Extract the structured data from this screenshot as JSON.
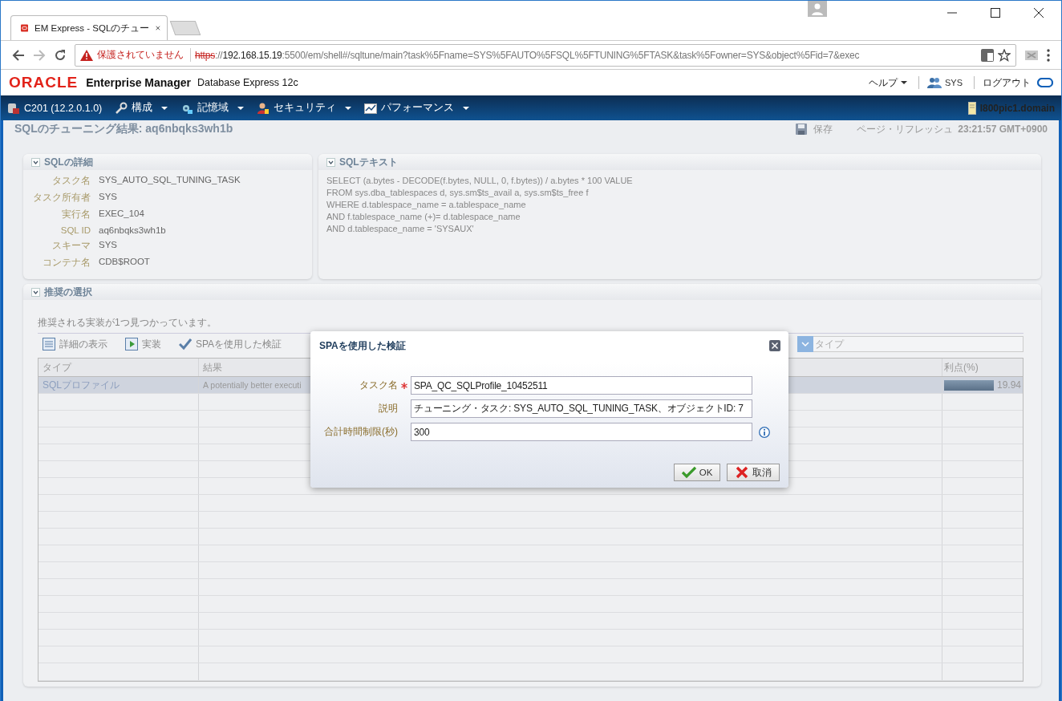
{
  "browser": {
    "tab_title": "EM Express - SQLのチュー",
    "url": {
      "warning": "保護されていません",
      "scheme": "https",
      "separator": "://",
      "host": "192.168.15.19",
      "path": ":5500/em/shell#/sqltune/main?task%5Fname=SYS%5FAUTO%5FSQL%5FTUNING%5FTASK&task%5Fowner=SYS&object%5Fid=7&exec"
    }
  },
  "header": {
    "brand": "ORACLE",
    "product": "Enterprise Manager",
    "edition": "Database Express 12c",
    "help": "ヘルプ",
    "user": "SYS",
    "logout": "ログアウト"
  },
  "nav": {
    "items": [
      {
        "label": "C201 (12.2.0.1.0)",
        "kind": "database",
        "menu": false
      },
      {
        "label": "構成",
        "kind": "wrench",
        "menu": true
      },
      {
        "label": "記憶域",
        "kind": "storage",
        "menu": true
      },
      {
        "label": "セキュリティ",
        "kind": "security",
        "menu": true
      },
      {
        "label": "パフォーマンス",
        "kind": "chart",
        "menu": true
      }
    ],
    "host": "l800pic1.domain"
  },
  "page": {
    "title": "SQLのチューニング結果: aq6nbqks3wh1b",
    "save": "保存",
    "refresh_label": "ページ・リフレッシュ",
    "refresh_time": "23:21:57 GMT+0900"
  },
  "details": {
    "title": "SQLの詳細",
    "expanded": true,
    "fields": [
      {
        "label": "タスク名",
        "value": "SYS_AUTO_SQL_TUNING_TASK"
      },
      {
        "label": "タスク所有者",
        "value": "SYS"
      },
      {
        "label": "実行名",
        "value": "EXEC_104"
      },
      {
        "label": "SQL ID",
        "value": "aq6nbqks3wh1b"
      },
      {
        "label": "スキーマ",
        "value": "SYS"
      },
      {
        "label": "コンテナ名",
        "value": "CDB$ROOT"
      }
    ]
  },
  "sql_text": {
    "title": "SQLテキスト",
    "expanded": true,
    "lines": [
      "SELECT (a.bytes - DECODE(f.bytes, NULL, 0, f.bytes)) / a.bytes * 100 VALUE",
      "FROM  sys.dba_tablespaces d, sys.sm$ts_avail a, sys.sm$ts_free f",
      "WHERE  d.tablespace_name = a.tablespace_name",
      "AND f.tablespace_name (+)= d.tablespace_name",
      "AND d.tablespace_name = 'SYSAUX'"
    ]
  },
  "recommendations": {
    "title": "推奨の選択",
    "expanded": true,
    "message": "推奨される実装が1つ見つかっています。",
    "toolbar": [
      {
        "label": "詳細の表示",
        "kind": "details"
      },
      {
        "label": "実装",
        "kind": "implement"
      },
      {
        "label": "SPAを使用した検証",
        "kind": "verify"
      }
    ],
    "filter": {
      "placeholder": "タイプ"
    },
    "table": {
      "columns": [
        "タイプ",
        "結果",
        "利点(%)"
      ],
      "rows": [
        {
          "type": "SQLプロファイル",
          "result": "A potentially better executi",
          "level": 1,
          "benefit": "19.94",
          "selected": true
        }
      ]
    }
  },
  "dialog": {
    "title": "SPAを使用した検証",
    "fields": [
      {
        "label": "タスク名",
        "required": true,
        "value": "SPA_QC_SQLProfile_10452511",
        "info": false
      },
      {
        "label": "説明",
        "required": false,
        "value": "チューニング・タスク: SYS_AUTO_SQL_TUNING_TASK、オブジェクトID: 7",
        "info": false
      },
      {
        "label": "合計時間制限(秒)",
        "required": false,
        "value": "300",
        "info": true
      }
    ],
    "buttons": [
      {
        "label": "OK",
        "kind": "ok"
      },
      {
        "label": "取消",
        "kind": "cancel"
      }
    ]
  }
}
